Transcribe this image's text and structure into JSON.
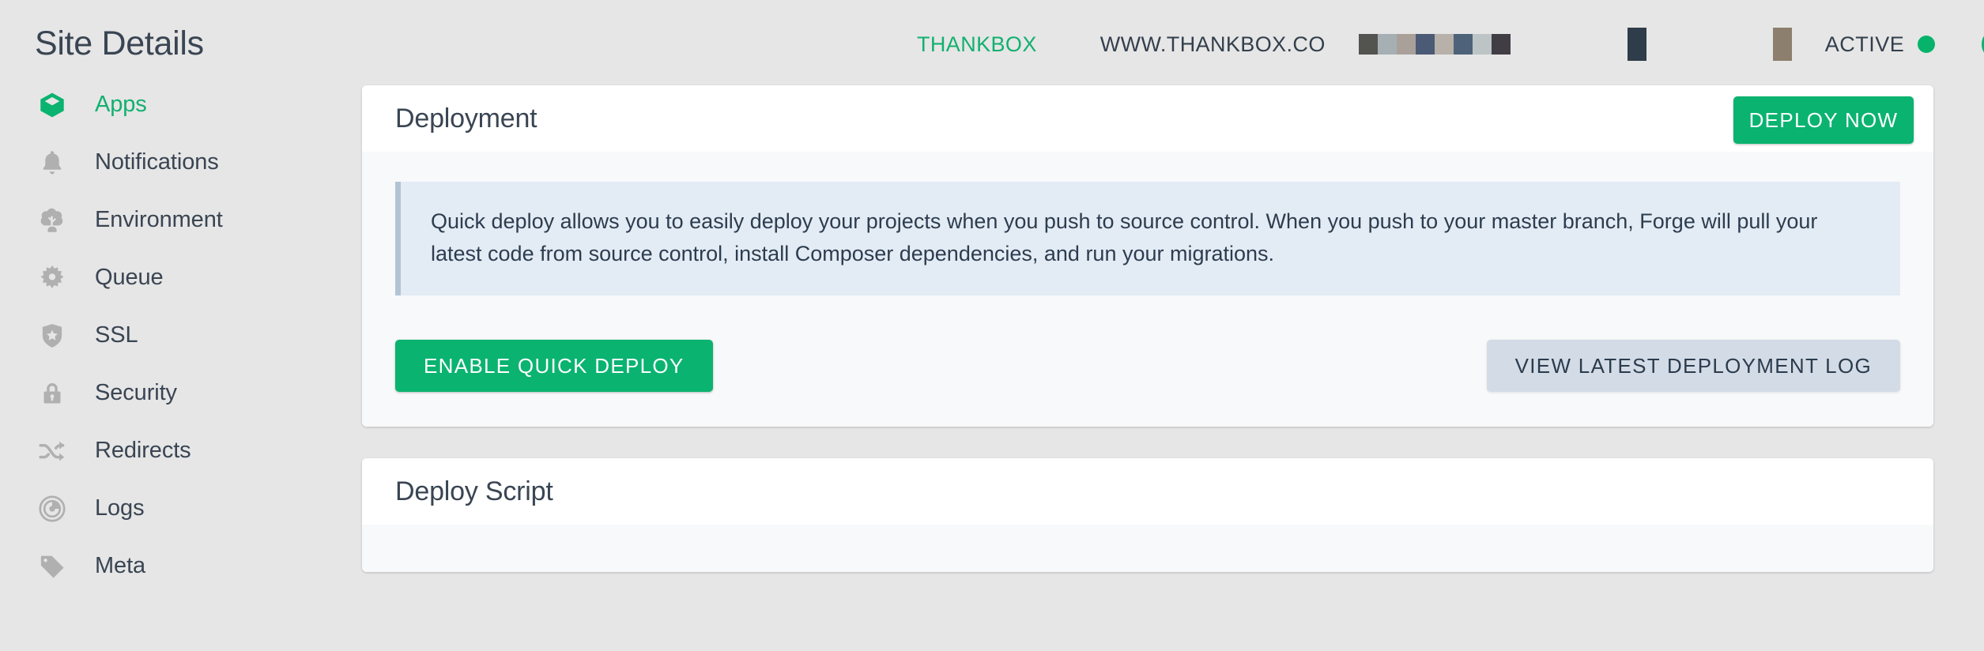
{
  "header": {
    "page_title": "Site Details",
    "brand_name": "THANKBOX",
    "brand_domain": "WWW.THANKBOX.CO",
    "status_label": "ACTIVE",
    "status_color": "#07b36a",
    "accent_color": "#13b070",
    "redacted_blocks": [
      "#53534f",
      "#a6afb3",
      "#aaa09a",
      "#4b5b75",
      "#b8b1aa",
      "#4e6279",
      "#bcc4c6",
      "#413d45"
    ],
    "redacted_single_dark": "#2f3c49",
    "redacted_single_tan": "#8c7f6d",
    "forward_arrow_icon": "arrow-right-circle-icon"
  },
  "sidebar": {
    "items": [
      {
        "label": "Apps",
        "icon": "cube-icon",
        "active": true
      },
      {
        "label": "Notifications",
        "icon": "bell-icon",
        "active": false
      },
      {
        "label": "Environment",
        "icon": "tree-icon",
        "active": false
      },
      {
        "label": "Queue",
        "icon": "gear-icon",
        "active": false
      },
      {
        "label": "SSL",
        "icon": "shield-star-icon",
        "active": false
      },
      {
        "label": "Security",
        "icon": "lock-icon",
        "active": false
      },
      {
        "label": "Redirects",
        "icon": "shuffle-icon",
        "active": false
      },
      {
        "label": "Logs",
        "icon": "pie-chart-icon",
        "active": false
      },
      {
        "label": "Meta",
        "icon": "tag-icon",
        "active": false
      }
    ]
  },
  "main": {
    "deployment_card": {
      "title": "Deployment",
      "deploy_now_label": "DEPLOY NOW",
      "callout_text": "Quick deploy allows you to easily deploy your projects when you push to source control. When you push to your master branch, Forge will pull your latest code from source control, install Composer dependencies, and run your migrations.",
      "enable_quick_deploy_label": "ENABLE QUICK DEPLOY",
      "view_log_label": "VIEW LATEST DEPLOYMENT LOG"
    },
    "deploy_script_card": {
      "title": "Deploy Script"
    }
  },
  "colors": {
    "green": "#0ab370",
    "grey_button": "#d3dce6",
    "callout_bg": "#e3ecf5",
    "callout_border": "#b3c4d4",
    "page_bg": "#e6e6e6",
    "card_body_bg": "#f8f9fa",
    "text_dark": "#3a4553"
  }
}
